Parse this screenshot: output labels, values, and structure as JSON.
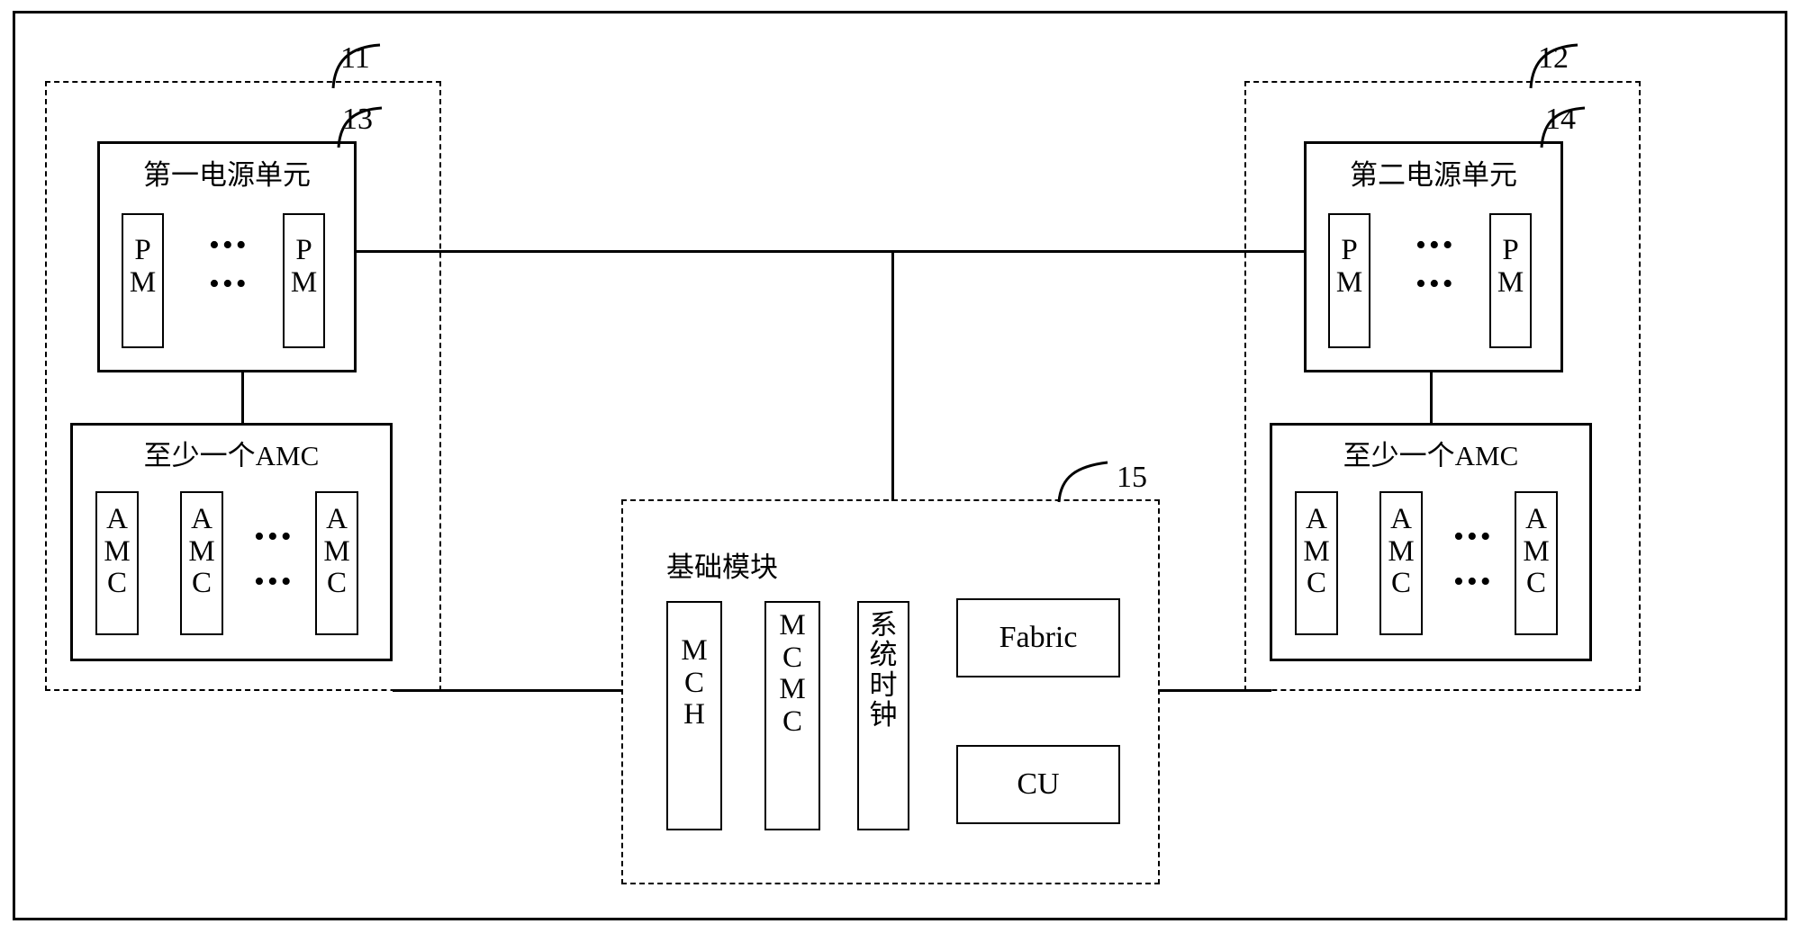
{
  "diagram": {
    "title": "",
    "reference_numbers": {
      "left_shelf": "11",
      "right_shelf": "12",
      "first_power_unit": "13",
      "second_power_unit": "14",
      "base_module": "15"
    },
    "ellipsis": "…",
    "dots": "•••",
    "left_shelf": {
      "power_unit": {
        "title": "第一电源单元",
        "modules": [
          {
            "lines": [
              "P",
              "M"
            ]
          },
          {
            "lines": [
              "P",
              "M"
            ]
          }
        ]
      },
      "amc_group": {
        "title": "至少一个AMC",
        "modules": [
          {
            "lines": [
              "A",
              "M",
              "C"
            ]
          },
          {
            "lines": [
              "A",
              "M",
              "C"
            ]
          },
          {
            "lines": [
              "A",
              "M",
              "C"
            ]
          }
        ]
      }
    },
    "right_shelf": {
      "power_unit": {
        "title": "第二电源单元",
        "modules": [
          {
            "lines": [
              "P",
              "M"
            ]
          },
          {
            "lines": [
              "P",
              "M"
            ]
          }
        ]
      },
      "amc_group": {
        "title": "至少一个AMC",
        "modules": [
          {
            "lines": [
              "A",
              "M",
              "C"
            ]
          },
          {
            "lines": [
              "A",
              "M",
              "C"
            ]
          },
          {
            "lines": [
              "A",
              "M",
              "C"
            ]
          }
        ]
      }
    },
    "base_module": {
      "title": "基础模块",
      "tall_blocks": [
        {
          "lines": [
            "M",
            "C",
            "H"
          ]
        },
        {
          "lines": [
            "M",
            "C",
            "M",
            "C"
          ]
        },
        {
          "lines": [
            "系",
            "统",
            "时",
            "钟"
          ]
        }
      ],
      "wide_blocks": [
        {
          "label": "Fabric"
        },
        {
          "label": "CU"
        }
      ]
    },
    "colors": {
      "stroke": "#000000",
      "background": "#ffffff"
    }
  }
}
